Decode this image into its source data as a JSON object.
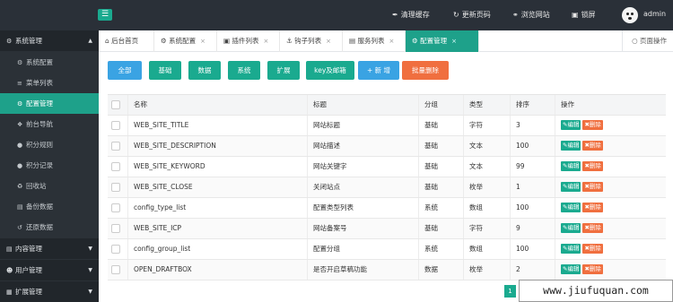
{
  "topbar": {
    "menu_toggle_icon": "hamburger-icon",
    "actions": [
      {
        "label": "清理缓存",
        "icon": "brush-icon"
      },
      {
        "label": "更新页码",
        "icon": "refresh-icon"
      },
      {
        "label": "浏览网站",
        "icon": "globe-icon"
      },
      {
        "label": "锁屏",
        "icon": "lock-icon"
      }
    ],
    "user": "admin"
  },
  "sidebar": {
    "items": [
      {
        "label": "系统管理",
        "icon": "wrench-icon",
        "kind": "group",
        "expanded": true
      },
      {
        "label": "系统配置",
        "icon": "gear-icon",
        "kind": "sub"
      },
      {
        "label": "菜单列表",
        "icon": "list-icon",
        "kind": "sub"
      },
      {
        "label": "配置管理",
        "icon": "cogs-icon",
        "kind": "sub",
        "active": true
      },
      {
        "label": "前台导航",
        "icon": "compass-icon",
        "kind": "sub"
      },
      {
        "label": "积分规则",
        "icon": "circle-icon",
        "kind": "sub"
      },
      {
        "label": "积分记录",
        "icon": "circle-icon",
        "kind": "sub"
      },
      {
        "label": "回收站",
        "icon": "recycle-icon",
        "kind": "sub"
      },
      {
        "label": "备份数据",
        "icon": "database-icon",
        "kind": "sub"
      },
      {
        "label": "还原数据",
        "icon": "undo-icon",
        "kind": "sub"
      },
      {
        "label": "内容管理",
        "icon": "file-icon",
        "kind": "group"
      },
      {
        "label": "用户管理",
        "icon": "user-icon",
        "kind": "group"
      },
      {
        "label": "扩展管理",
        "icon": "puzzle-icon",
        "kind": "group"
      }
    ]
  },
  "tabs": {
    "items": [
      {
        "label": "后台首页",
        "icon": "home-icon",
        "closable": false
      },
      {
        "label": "系统配置",
        "icon": "gear-icon",
        "closable": true
      },
      {
        "label": "插件列表",
        "icon": "plugin-icon",
        "closable": true
      },
      {
        "label": "钩子列表",
        "icon": "anchor-icon",
        "closable": true
      },
      {
        "label": "服务列表",
        "icon": "server-icon",
        "closable": true
      },
      {
        "label": "配置管理",
        "icon": "cogs-icon",
        "closable": true,
        "active": true
      }
    ],
    "page_ops": "页面操作"
  },
  "toolbar": {
    "buttons": [
      {
        "label": "全部",
        "style": "blue"
      },
      {
        "label": "基础",
        "style": "teal"
      },
      {
        "label": "数据",
        "style": "teal"
      },
      {
        "label": "系统",
        "style": "teal"
      },
      {
        "label": "扩展",
        "style": "teal"
      },
      {
        "label": "key及邮箱",
        "style": "teal"
      },
      {
        "label": "+ 新 增",
        "style": "blue"
      },
      {
        "label": "批量删除",
        "style": "orange"
      }
    ]
  },
  "table": {
    "columns": [
      "名称",
      "标题",
      "分组",
      "类型",
      "排序",
      "操作"
    ],
    "edit_label": "编辑",
    "delete_label": "删除",
    "rows": [
      {
        "name": "WEB_SITE_TITLE",
        "title": "网站标题",
        "group": "基础",
        "type": "字符",
        "sort": "3"
      },
      {
        "name": "WEB_SITE_DESCRIPTION",
        "title": "网站描述",
        "group": "基础",
        "type": "文本",
        "sort": "100"
      },
      {
        "name": "WEB_SITE_KEYWORD",
        "title": "网站关键字",
        "group": "基础",
        "type": "文本",
        "sort": "99"
      },
      {
        "name": "WEB_SITE_CLOSE",
        "title": "关闭站点",
        "group": "基础",
        "type": "枚举",
        "sort": "1"
      },
      {
        "name": "config_type_list",
        "title": "配置类型列表",
        "group": "系统",
        "type": "数组",
        "sort": "100"
      },
      {
        "name": "WEB_SITE_ICP",
        "title": "网站备案号",
        "group": "基础",
        "type": "字符",
        "sort": "9"
      },
      {
        "name": "config_group_list",
        "title": "配置分组",
        "group": "系统",
        "type": "数组",
        "sort": "100"
      },
      {
        "name": "OPEN_DRAFTBOX",
        "title": "是否开启草稿功能",
        "group": "数据",
        "type": "枚举",
        "sort": "2"
      }
    ]
  },
  "pagination": {
    "current": "1"
  },
  "watermark": "www.jiufuquan.com",
  "colors": {
    "accent": "#1aaa8f",
    "blue": "#3aa3e3",
    "orange": "#f06f3f",
    "topbar": "#2a3038",
    "sidebar": "#2b3137"
  }
}
